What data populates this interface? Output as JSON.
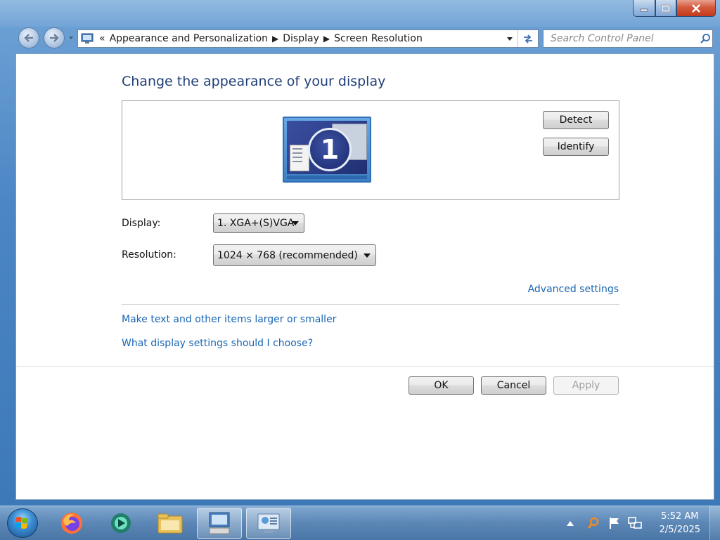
{
  "window": {
    "caption_buttons": [
      "minimize",
      "maximize",
      "close"
    ]
  },
  "address_bar": {
    "overflow_chevron": "«",
    "breadcrumbs": [
      "Appearance and Personalization",
      "Display",
      "Screen Resolution"
    ]
  },
  "search": {
    "placeholder": "Search Control Panel"
  },
  "main": {
    "title": "Change the appearance of your display",
    "preview": {
      "monitor_number": "1",
      "detect_label": "Detect",
      "identify_label": "Identify"
    },
    "display_label": "Display:",
    "display_value": "1. XGA+(S)VGA",
    "resolution_label": "Resolution:",
    "resolution_value": "1024 × 768 (recommended)",
    "advanced_link": "Advanced settings",
    "links": [
      "Make text and other items larger or smaller",
      "What display settings should I choose?"
    ]
  },
  "footer": {
    "ok_label": "OK",
    "cancel_label": "Cancel",
    "apply_label": "Apply"
  },
  "taskbar": {
    "apps": [
      "firefox-icon",
      "app-icon",
      "explorer-icon",
      "control-panel-icon",
      "display-settings-icon"
    ],
    "clock_time": "5:52 AM",
    "clock_date": "2/5/2025"
  },
  "colors": {
    "title": "#1f3e78",
    "link": "#1a66b3"
  }
}
